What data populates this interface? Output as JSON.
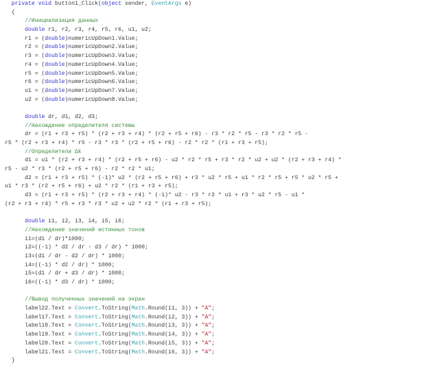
{
  "editor": {
    "colors": {
      "keyword": "#2f2fd0",
      "comment": "#3c8c3c",
      "type": "#3aa0b0",
      "string": "#b0202a",
      "text": "#3a3a3a"
    },
    "lines": [
      [
        [
          "tx",
          "  "
        ],
        [
          "kw",
          "private"
        ],
        [
          "tx",
          " "
        ],
        [
          "kw",
          "void"
        ],
        [
          "tx",
          " button1_Click("
        ],
        [
          "kw",
          "object"
        ],
        [
          "tx",
          " sender, "
        ],
        [
          "ty",
          "EventArgs"
        ],
        [
          "tx",
          " e)"
        ]
      ],
      [
        [
          "tx",
          "  {"
        ]
      ],
      [
        [
          "tx",
          "      "
        ],
        [
          "cm",
          "//Инициализация данных"
        ]
      ],
      [
        [
          "tx",
          "      "
        ],
        [
          "kw",
          "double"
        ],
        [
          "tx",
          " r1, r2, r3, r4, r5, r6, u1, u2;"
        ]
      ],
      [
        [
          "tx",
          "      r1 = ("
        ],
        [
          "kw",
          "double"
        ],
        [
          "tx",
          ")numericUpDown1.Value;"
        ]
      ],
      [
        [
          "tx",
          "      r2 = ("
        ],
        [
          "kw",
          "double"
        ],
        [
          "tx",
          ")numericUpDown2.Value;"
        ]
      ],
      [
        [
          "tx",
          "      r3 = ("
        ],
        [
          "kw",
          "double"
        ],
        [
          "tx",
          ")numericUpDown3.Value;"
        ]
      ],
      [
        [
          "tx",
          "      r4 = ("
        ],
        [
          "kw",
          "double"
        ],
        [
          "tx",
          ")numericUpDown4.Value;"
        ]
      ],
      [
        [
          "tx",
          "      r5 = ("
        ],
        [
          "kw",
          "double"
        ],
        [
          "tx",
          ")numericUpDown5.Value;"
        ]
      ],
      [
        [
          "tx",
          "      r6 = ("
        ],
        [
          "kw",
          "double"
        ],
        [
          "tx",
          ")numericUpDown6.Value;"
        ]
      ],
      [
        [
          "tx",
          "      u1 = ("
        ],
        [
          "kw",
          "double"
        ],
        [
          "tx",
          ")numericUpDown7.Value;"
        ]
      ],
      [
        [
          "tx",
          "      u2 = ("
        ],
        [
          "kw",
          "double"
        ],
        [
          "tx",
          ")numericUpDown8.Value;"
        ]
      ],
      [],
      [
        [
          "tx",
          "      "
        ],
        [
          "kw",
          "double"
        ],
        [
          "tx",
          " dr, d1, d2, d3;"
        ]
      ],
      [
        [
          "tx",
          "      "
        ],
        [
          "cm",
          "//Нахождение определителя системы"
        ]
      ],
      [
        [
          "tx",
          "      dr = (r1 + r3 + r5) * (r2 + r3 + r4) * (r2 + r5 + r6) - r3 * r2 * r5 - r3 * r2 * r5 -"
        ]
      ],
      [
        [
          "tx",
          "r5 * (r2 + r3 + r4) * r5 - r3 * r3 * (r2 + r5 + r6) - r2 * r2 * (r1 + r3 + r5);"
        ]
      ],
      [
        [
          "tx",
          "      "
        ],
        [
          "cm",
          "//Определители Δk"
        ]
      ],
      [
        [
          "tx",
          "      d1 = u1 * (r2 + r3 + r4) * (r2 + r5 + r6) - u2 * r2 * r5 + r3 * r2 * u2 + u2 * (r2 + r3 + r4) *"
        ]
      ],
      [
        [
          "tx",
          "r5 - u2 * r3 * (r2 + r5 + r6) - r2 * r2 * u1;"
        ]
      ],
      [
        [
          "tx",
          "      d2 = (r1 + r3 + r5) * (-1)* u2 * (r2 + r5 + r6) + r3 * u2 * r5 + u1 * r2 * r5 + r5 * u2 * r5 +"
        ]
      ],
      [
        [
          "tx",
          "u1 * r3 * (r2 + r5 + r6) + u2 * r2 * (r1 + r3 + r5);"
        ]
      ],
      [
        [
          "tx",
          "      d3 = (r1 + r3 + r5) * (r2 + r3 + r4) * (-1)* u2 - r3 * r2 * u1 + r3 * u2 * r5 - u1 *"
        ]
      ],
      [
        [
          "tx",
          "(r2 + r3 + r4) * r5 + r3 * r3 * u2 + u2 * r2 * (r1 + r3 + r5);"
        ]
      ],
      [],
      [
        [
          "tx",
          "      "
        ],
        [
          "kw",
          "double"
        ],
        [
          "tx",
          " i1, i2, i3, i4, i5, i6;"
        ]
      ],
      [
        [
          "tx",
          "      "
        ],
        [
          "cm",
          "//Нахождение значений истинных токов"
        ]
      ],
      [
        [
          "tx",
          "      i1=(d1 / dr)*1000;"
        ]
      ],
      [
        [
          "tx",
          "      i2=((-1) * d2 / dr - d3 / dr) * 1000;"
        ]
      ],
      [
        [
          "tx",
          "      i3=(d1 / dr - d2 / dr) * 1000;"
        ]
      ],
      [
        [
          "tx",
          "      i4=((-1) * d2 / dr) * 1000;"
        ]
      ],
      [
        [
          "tx",
          "      i5=(d1 / dr + d3 / dr) * 1000;"
        ]
      ],
      [
        [
          "tx",
          "      i6=((-1) * d3 / dr) * 1000;"
        ]
      ],
      [],
      [
        [
          "tx",
          "      "
        ],
        [
          "cm",
          "//Вывод полученных значений на экран"
        ]
      ],
      [
        [
          "tx",
          "      label22.Text = "
        ],
        [
          "ty",
          "Convert"
        ],
        [
          "tx",
          ".ToString("
        ],
        [
          "ty",
          "Math"
        ],
        [
          "tx",
          ".Round(i1, 3)) + "
        ],
        [
          "st",
          "\"A\""
        ],
        [
          "tx",
          ";"
        ]
      ],
      [
        [
          "tx",
          "      label17.Text = "
        ],
        [
          "ty",
          "Convert"
        ],
        [
          "tx",
          ".ToString("
        ],
        [
          "ty",
          "Math"
        ],
        [
          "tx",
          ".Round(i2, 3)) + "
        ],
        [
          "st",
          "\"A\""
        ],
        [
          "tx",
          ";"
        ]
      ],
      [
        [
          "tx",
          "      label18.Text = "
        ],
        [
          "ty",
          "Convert"
        ],
        [
          "tx",
          ".ToString("
        ],
        [
          "ty",
          "Math"
        ],
        [
          "tx",
          ".Round(i3, 3)) + "
        ],
        [
          "st",
          "\"A\""
        ],
        [
          "tx",
          ";"
        ]
      ],
      [
        [
          "tx",
          "      label19.Text = "
        ],
        [
          "ty",
          "Convert"
        ],
        [
          "tx",
          ".ToString("
        ],
        [
          "ty",
          "Math"
        ],
        [
          "tx",
          ".Round(i4, 3)) + "
        ],
        [
          "st",
          "\"A\""
        ],
        [
          "tx",
          ";"
        ]
      ],
      [
        [
          "tx",
          "      label20.Text = "
        ],
        [
          "ty",
          "Convert"
        ],
        [
          "tx",
          ".ToString("
        ],
        [
          "ty",
          "Math"
        ],
        [
          "tx",
          ".Round(i5, 3)) + "
        ],
        [
          "st",
          "\"A\""
        ],
        [
          "tx",
          ";"
        ]
      ],
      [
        [
          "tx",
          "      label21.Text = "
        ],
        [
          "ty",
          "Convert"
        ],
        [
          "tx",
          ".ToString("
        ],
        [
          "ty",
          "Math"
        ],
        [
          "tx",
          ".Round(i6, 3)) + "
        ],
        [
          "st",
          "\"A\""
        ],
        [
          "tx",
          ";"
        ]
      ],
      [
        [
          "tx",
          "  }"
        ]
      ]
    ]
  }
}
